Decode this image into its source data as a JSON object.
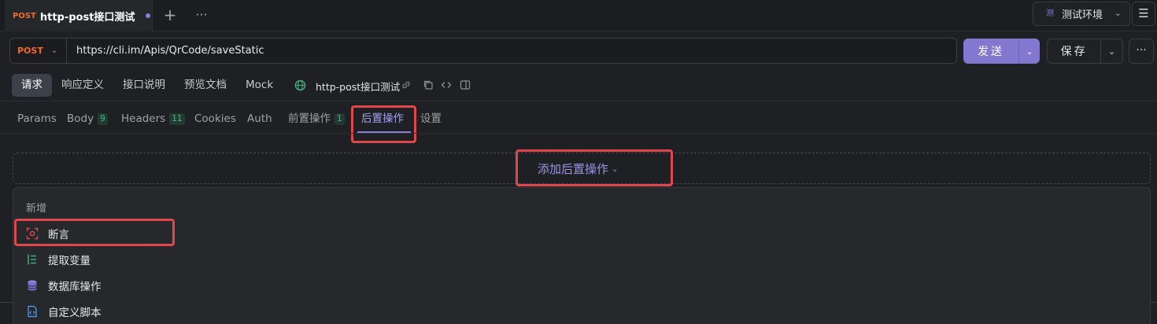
{
  "tab": {
    "method": "POST",
    "title": "http-post接口测试",
    "plus": "+",
    "more": "···"
  },
  "env": {
    "icon_text": "测",
    "label": "测试环境"
  },
  "request": {
    "method": "POST",
    "url": "https://cli.im/Apis/QrCode/saveStatic",
    "send_label": "发送",
    "save_label": "保存",
    "more_label": "···"
  },
  "subtabs": [
    {
      "label": "请求",
      "active": true
    },
    {
      "label": "响应定义",
      "active": false
    },
    {
      "label": "接口说明",
      "active": false
    },
    {
      "label": "预览文档",
      "active": false
    },
    {
      "label": "Mock",
      "active": false
    }
  ],
  "api_name": "http-post接口测试",
  "param_tabs": [
    {
      "label": "Params",
      "badge": ""
    },
    {
      "label": "Body",
      "badge": "9"
    },
    {
      "label": "Headers",
      "badge": "11"
    },
    {
      "label": "Cookies",
      "badge": ""
    },
    {
      "label": "Auth",
      "badge": ""
    },
    {
      "label": "前置操作",
      "badge": "1"
    },
    {
      "label": "后置操作",
      "badge": "",
      "active": true
    },
    {
      "label": "设置",
      "badge": ""
    }
  ],
  "add_post_action": "添加后置操作",
  "dropdown": {
    "header": "新增",
    "items": [
      {
        "label": "断言",
        "icon": "assertion-icon"
      },
      {
        "label": "提取变量",
        "icon": "extract-variable-icon"
      },
      {
        "label": "数据库操作",
        "icon": "database-icon"
      },
      {
        "label": "自定义脚本",
        "icon": "script-icon"
      }
    ]
  },
  "colors": {
    "accent": "#8b7fd9",
    "method": "#ef6b2c",
    "highlight": "#e0474d",
    "send_button": "#8377cf"
  }
}
